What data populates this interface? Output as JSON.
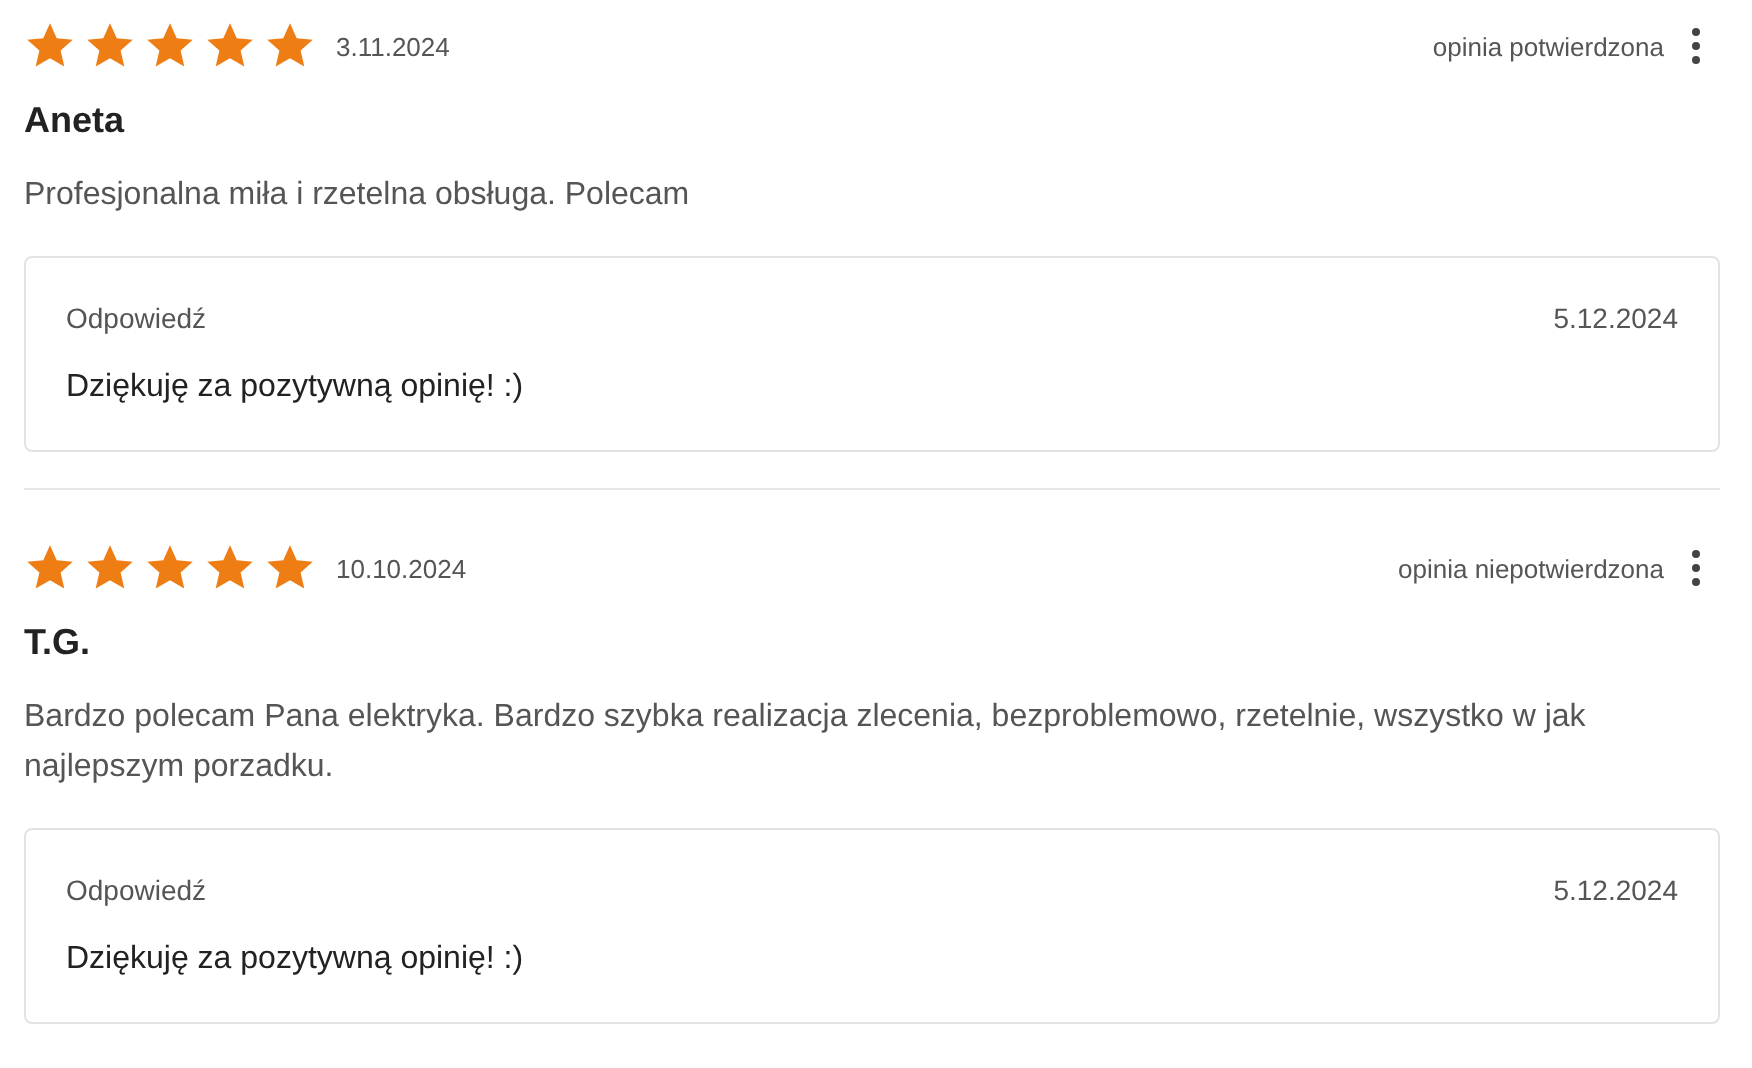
{
  "reviews": [
    {
      "stars": 5,
      "date": "3.11.2024",
      "status": "opinia potwierdzona",
      "author": "Aneta",
      "text": "Profesjonalna miła i rzetelna obsługa. Polecam",
      "reply": {
        "label": "Odpowiedź",
        "date": "5.12.2024",
        "text": "Dziękuję za pozytywną opinię! :)"
      }
    },
    {
      "stars": 5,
      "date": "10.10.2024",
      "status": "opinia niepotwierdzona",
      "author": "T.G.",
      "text": "Bardzo polecam Pana elektryka. Bardzo szybka realizacja zlecenia, bezproblemowo, rzetelnie, wszystko w jak najlepszym porzadku.",
      "reply": {
        "label": "Odpowiedź",
        "date": "5.12.2024",
        "text": "Dziękuję za pozytywną opinię! :)"
      }
    }
  ]
}
